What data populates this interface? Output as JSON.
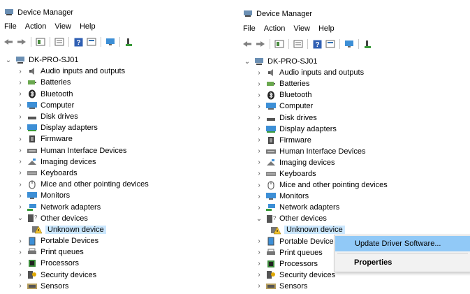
{
  "window": {
    "title": "Device Manager"
  },
  "menu": [
    "File",
    "Action",
    "View",
    "Help"
  ],
  "toolbar_icons": [
    "back-arrow-icon",
    "forward-arrow-icon",
    "properties-icon",
    "show-hidden-icon",
    "help-icon",
    "view-icon",
    "monitor-icon",
    "scan-hardware-icon"
  ],
  "tree": {
    "root": "DK-PRO-SJ01",
    "categories": [
      {
        "label": "Audio inputs and outputs",
        "icon": "speaker-icon"
      },
      {
        "label": "Batteries",
        "icon": "battery-icon"
      },
      {
        "label": "Bluetooth",
        "icon": "bluetooth-icon"
      },
      {
        "label": "Computer",
        "icon": "computer-icon"
      },
      {
        "label": "Disk drives",
        "icon": "disk-icon"
      },
      {
        "label": "Display adapters",
        "icon": "display-icon"
      },
      {
        "label": "Firmware",
        "icon": "chip-icon"
      },
      {
        "label": "Human Interface Devices",
        "icon": "hid-icon"
      },
      {
        "label": "Imaging devices",
        "icon": "camera-icon"
      },
      {
        "label": "Keyboards",
        "icon": "keyboard-icon"
      },
      {
        "label": "Mice and other pointing devices",
        "icon": "mouse-icon"
      },
      {
        "label": "Monitors",
        "icon": "monitor-icon"
      },
      {
        "label": "Network adapters",
        "icon": "network-icon"
      },
      {
        "label": "Other devices",
        "icon": "other-devices-icon",
        "expanded": true,
        "children": [
          {
            "label": "Unknown device",
            "icon": "warning-device-icon"
          }
        ]
      },
      {
        "label": "Portable Devices",
        "icon": "portable-icon"
      },
      {
        "label": "Print queues",
        "icon": "printer-icon"
      },
      {
        "label": "Processors",
        "icon": "processor-icon"
      },
      {
        "label": "Security devices",
        "icon": "security-icon"
      },
      {
        "label": "Sensors",
        "icon": "sensor-icon"
      }
    ]
  },
  "context_menu": {
    "items": [
      "Update Driver Software...",
      "Properties"
    ]
  },
  "colors": {
    "selection": "#cce8ff",
    "menu_highlight": "#91c9f7"
  }
}
